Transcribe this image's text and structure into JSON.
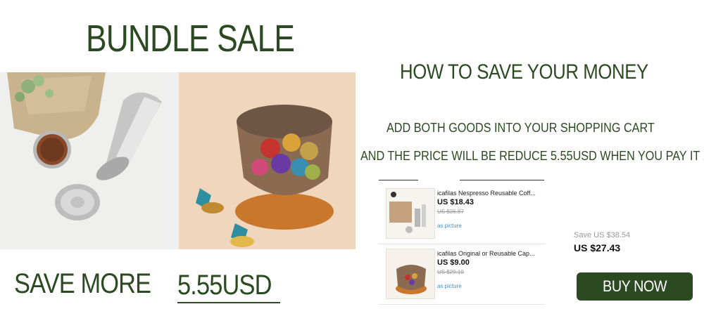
{
  "banner": {
    "title": "BUNDLE SALE",
    "save_more": "SAVE MORE",
    "save_amount": "5.55USD"
  },
  "instructions": {
    "heading": "HOW TO SAVE YOUR MONEY",
    "step1": "ADD BOTH GOODS INTO YOUR SHOPPING CART",
    "step2": "AND THE PRICE WILL BE REDUCE 5.55USD WHEN YOU PAY IT ."
  },
  "products": [
    {
      "name": "icafilas Nespresso Reusable Coff...",
      "price": "US $18.43",
      "old_price": "US $36.87",
      "note": "as picture"
    },
    {
      "name": "icafilas Original or Reusable Cap...",
      "price": "US $9.00",
      "old_price": "US $29.10",
      "note": "as picture"
    }
  ],
  "bundle": {
    "old_price": "Save US $38.54",
    "new_price": "US $27.43",
    "buy_label": "BUY NOW"
  },
  "colors": {
    "accent": "#2c4a21",
    "link": "#4a8ec2"
  }
}
